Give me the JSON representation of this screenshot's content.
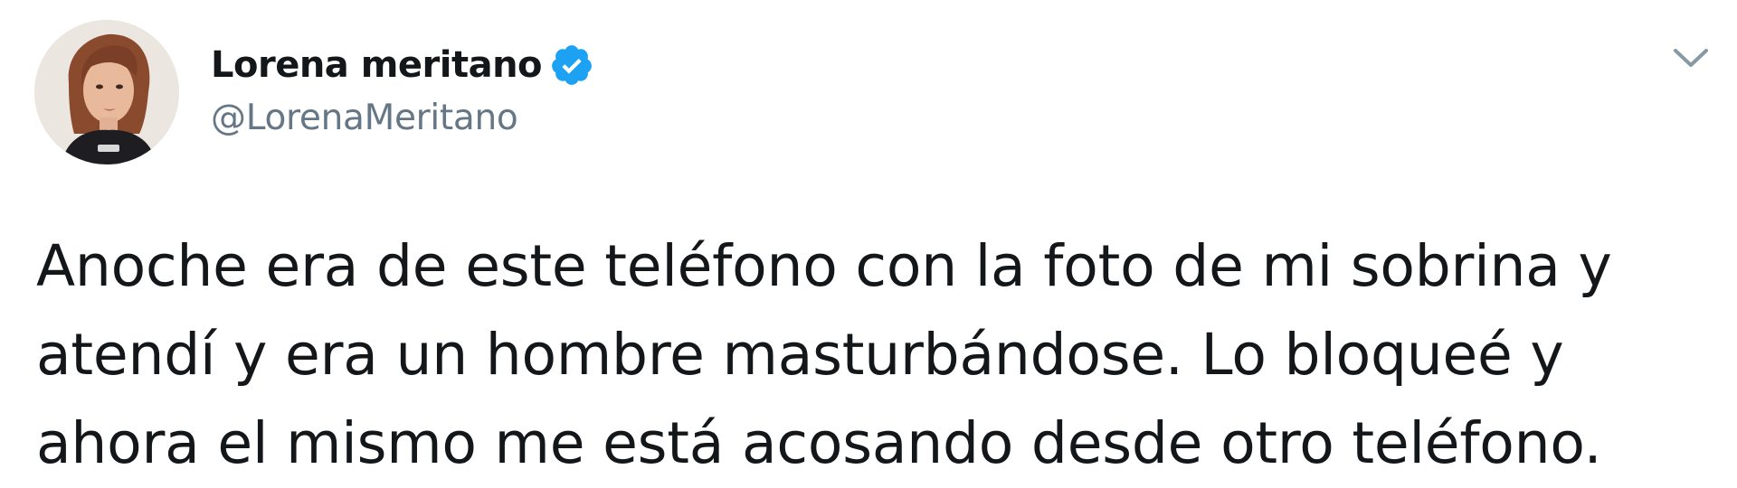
{
  "author": {
    "display_name": "Lorena meritano",
    "handle": "@LorenaMeritano",
    "verified": true
  },
  "tweet": {
    "text_lines": [
      "Anoche era de este teléfono con la foto de mi sobrina y",
      "atendí y era un hombre masturbándose. Lo bloqueé y",
      "ahora el mismo me está acosando desde otro teléfono."
    ]
  },
  "icons": {
    "verified": "verified-badge-icon",
    "menu": "chevron-down-icon"
  },
  "colors": {
    "verified_blue": "#1da1f2",
    "text": "#14171a",
    "secondary_text": "#657786",
    "chevron": "#8899a6"
  }
}
